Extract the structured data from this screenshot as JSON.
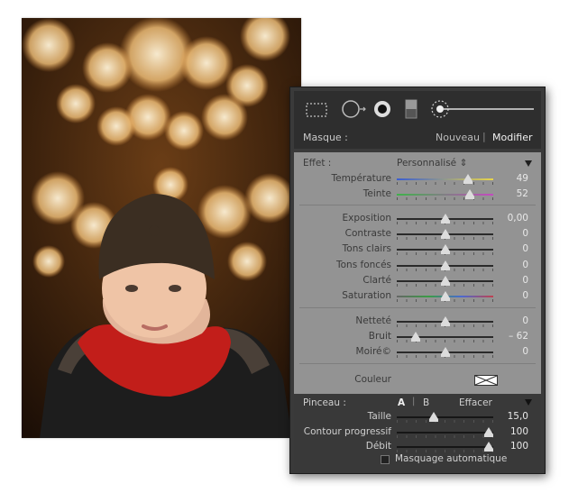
{
  "mask": {
    "label": "Masque :",
    "new": "Nouveau",
    "edit": "Modifier"
  },
  "effect": {
    "label": "Effet :",
    "preset": "Personnalisé ⇕"
  },
  "sliders_color": [
    {
      "label": "Température",
      "value": "49",
      "pos": 0.74,
      "gradient": "linear-gradient(90deg,#3a5dd0,#e8d54a)"
    },
    {
      "label": "Teinte",
      "value": "52",
      "pos": 0.76,
      "gradient": "linear-gradient(90deg,#3fb24a,#c44ac0)"
    }
  ],
  "sliders_tone": [
    {
      "label": "Exposition",
      "value": "0,00",
      "pos": 0.5
    },
    {
      "label": "Contraste",
      "value": "0",
      "pos": 0.5
    },
    {
      "label": "Tons clairs",
      "value": "0",
      "pos": 0.5
    },
    {
      "label": "Tons foncés",
      "value": "0",
      "pos": 0.5
    },
    {
      "label": "Clarté",
      "value": "0",
      "pos": 0.5
    },
    {
      "label": "Saturation",
      "value": "0",
      "pos": 0.5,
      "gradient": "linear-gradient(90deg,#666,#3a9d45,#4a6ad1,#c0414f)"
    }
  ],
  "sliders_detail": [
    {
      "label": "Netteté",
      "value": "0",
      "pos": 0.5
    },
    {
      "label": "Bruit",
      "value": "– 62",
      "pos": 0.2
    },
    {
      "label": "Moiré©",
      "value": "0",
      "pos": 0.5
    }
  ],
  "color": {
    "label": "Couleur"
  },
  "brush": {
    "label": "Pinceau :",
    "a": "A",
    "b": "B",
    "erase": "Effacer"
  },
  "sliders_brush": [
    {
      "label": "Taille",
      "value": "15,0",
      "pos": 0.38
    },
    {
      "label": "Contour progressif",
      "value": "100",
      "pos": 0.95
    },
    {
      "label": "Débit",
      "value": "100",
      "pos": 0.95
    }
  ],
  "automask": {
    "label": "Masquage automatique"
  },
  "icons": [
    "marquee-icon",
    "spot-removal-icon",
    "red-eye-icon",
    "graduated-filter-icon",
    "adjustment-brush-icon"
  ]
}
